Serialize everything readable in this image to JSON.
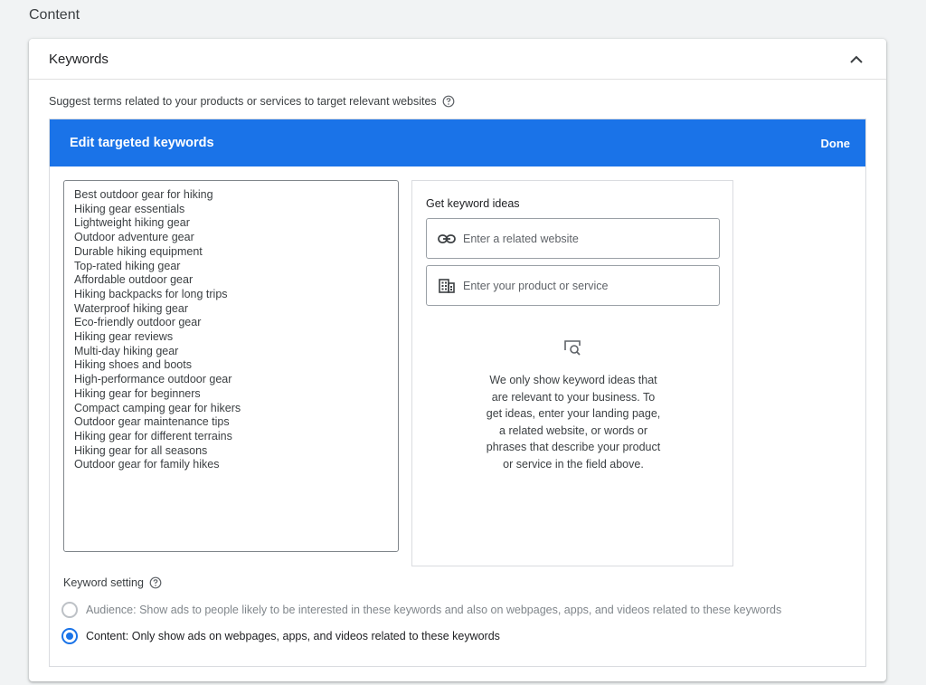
{
  "page": {
    "section_title": "Content"
  },
  "card": {
    "title": "Keywords",
    "suggest_text": "Suggest terms related to your products or services to target relevant websites"
  },
  "editor": {
    "title": "Edit targeted keywords",
    "done_label": "Done",
    "keywords": [
      "Best outdoor gear for hiking",
      "Hiking gear essentials",
      "Lightweight hiking gear",
      "Outdoor adventure gear",
      "Durable hiking equipment",
      "Top-rated hiking gear",
      "Affordable outdoor gear",
      "Hiking backpacks for long trips",
      "Waterproof hiking gear",
      "Eco-friendly outdoor gear",
      "Hiking gear reviews",
      "Multi-day hiking gear",
      "Hiking shoes and boots",
      "High-performance outdoor gear",
      "Hiking gear for beginners",
      "Compact camping gear for hikers",
      "Outdoor gear maintenance tips",
      "Hiking gear for different terrains",
      "Hiking gear for all seasons",
      "Outdoor gear for family hikes"
    ]
  },
  "ideas": {
    "title": "Get keyword ideas",
    "website_placeholder": "Enter a related website",
    "product_placeholder": "Enter your product or service",
    "info_text": "We only show keyword ideas that are relevant to your business. To get ideas, enter your landing page, a related website, or words or phrases that describe your product or service in the field above."
  },
  "keyword_setting": {
    "label": "Keyword setting",
    "options": [
      {
        "label": "Audience: Show ads to people likely to be interested in these keywords and also on webpages, apps, and videos related to these keywords",
        "selected": false
      },
      {
        "label": "Content: Only show ads on webpages, apps, and videos related to these keywords",
        "selected": true
      }
    ]
  },
  "colors": {
    "accent": "#1a73e8",
    "background": "#f1f3f4"
  }
}
